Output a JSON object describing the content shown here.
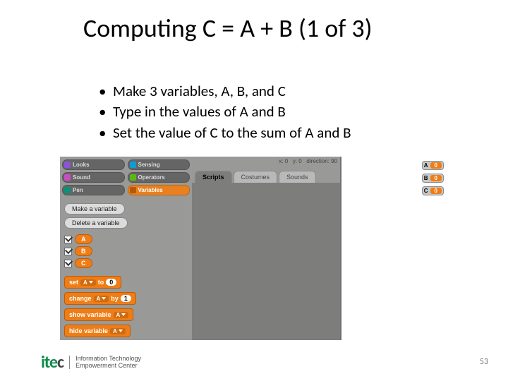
{
  "title": "Computing  C = A + B (1 of 3)",
  "bullets": [
    "Make 3 variables, A, B, and C",
    "Type in the values of A and B",
    "Set the value of C to the sum of A and B"
  ],
  "palette": {
    "looks": "Looks",
    "sensing": "Sensing",
    "sound": "Sound",
    "operators": "Operators",
    "pen": "Pen",
    "variables": "Variables"
  },
  "buttons": {
    "make": "Make a variable",
    "delete": "Delete a variable"
  },
  "vars": [
    {
      "name": "A",
      "checked": true
    },
    {
      "name": "B",
      "checked": true
    },
    {
      "name": "C",
      "checked": true
    }
  ],
  "blocks": {
    "set": "set",
    "to": "to",
    "set_dd": "A",
    "set_val": "0",
    "change": "change",
    "by": "by",
    "change_dd": "A",
    "change_val": "1",
    "show": "show variable",
    "show_dd": "A",
    "hide": "hide variable",
    "hide_dd": "A"
  },
  "sprite_info": {
    "x": "x: 0",
    "y": "y: 0",
    "dir": "direction: 90"
  },
  "tabs": {
    "scripts": "Scripts",
    "costumes": "Costumes",
    "sounds": "Sounds"
  },
  "monitors": [
    {
      "label": "A",
      "value": "0"
    },
    {
      "label": "B",
      "value": "0"
    },
    {
      "label": "C",
      "value": "0"
    }
  ],
  "logo": {
    "mark_pre": "ite",
    "mark_post": "c",
    "line1": "Information Technology",
    "line2": "Empowerment Center"
  },
  "page": "53"
}
